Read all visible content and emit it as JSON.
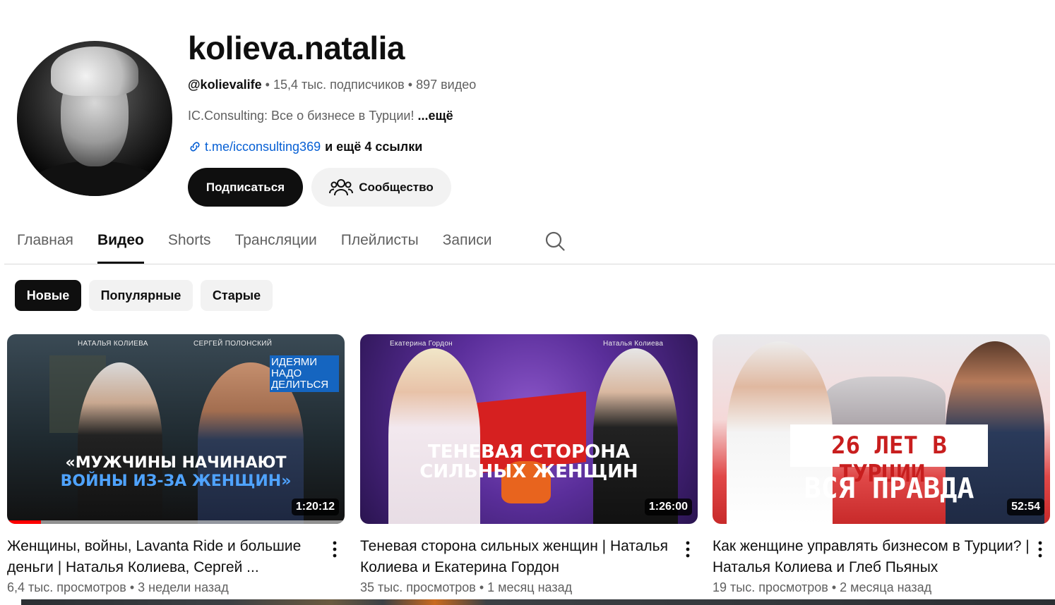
{
  "channel": {
    "name": "kolieva.natalia",
    "handle": "@kolievalife",
    "subscribers": "15,4 тыс. подписчиков",
    "videos_count": "897 видео",
    "separator": "•",
    "description": "IC.Consulting: Все о бизнесе в Турции!",
    "more_label": "...ещё",
    "link": "t.me/icconsulting369",
    "more_links": "и ещё 4 ссылки"
  },
  "buttons": {
    "subscribe": "Подписаться",
    "community": "Сообщество"
  },
  "tabs": [
    {
      "label": "Главная",
      "active": false
    },
    {
      "label": "Видео",
      "active": true
    },
    {
      "label": "Shorts",
      "active": false
    },
    {
      "label": "Трансляции",
      "active": false
    },
    {
      "label": "Плейлисты",
      "active": false
    },
    {
      "label": "Записи",
      "active": false
    }
  ],
  "chips": [
    {
      "label": "Новые",
      "active": true
    },
    {
      "label": "Популярные",
      "active": false
    },
    {
      "label": "Старые",
      "active": false
    }
  ],
  "videos": [
    {
      "title": "Женщины, войны, Lavanta Ride и большие деньги | Наталья Колиева, Сергей ...",
      "views": "6,4 тыс. просмотров",
      "age": "3 недели назад",
      "duration": "1:20:12",
      "watched_fraction": 0.1,
      "thumb_names": [
        "НАТАЛЬЯ КОЛИЕВА",
        "СЕРГЕЙ ПОЛОНСКИЙ"
      ],
      "thumb_badge": [
        "ИДЕЯМИ",
        "НАДО",
        "ДЕЛИТЬСЯ"
      ],
      "thumb_line1": "«МУЖЧИНЫ НАЧИНАЮТ",
      "thumb_line2": "ВОЙНЫ ИЗ-ЗА ЖЕНЩИН»"
    },
    {
      "title": "Теневая сторона сильных женщин | Наталья Колиева и Екатерина Гордон",
      "views": "35 тыс. просмотров",
      "age": "1 месяц назад",
      "duration": "1:26:00",
      "thumb_names": [
        "Екатерина Гордон",
        "Наталья Колиева"
      ],
      "thumb_line1": "ТЕНЕВАЯ СТОРОНА",
      "thumb_line2": "СИЛЬНЫХ ЖЕНЩИН"
    },
    {
      "title": "Как женщине управлять бизнесом в Турции? | Наталья Колиева и Глеб Пьяных",
      "views": "19 тыс. просмотров",
      "age": "2 месяца назад",
      "duration": "52:54",
      "thumb_line1": "26 ЛЕТ В ТУРЦИИ.",
      "thumb_line2": "ВСЯ ПРАВДА"
    }
  ],
  "colors": {
    "link": "#065fd4",
    "subscribe_bg": "#0f0f0f",
    "progress": "#ff0000"
  }
}
